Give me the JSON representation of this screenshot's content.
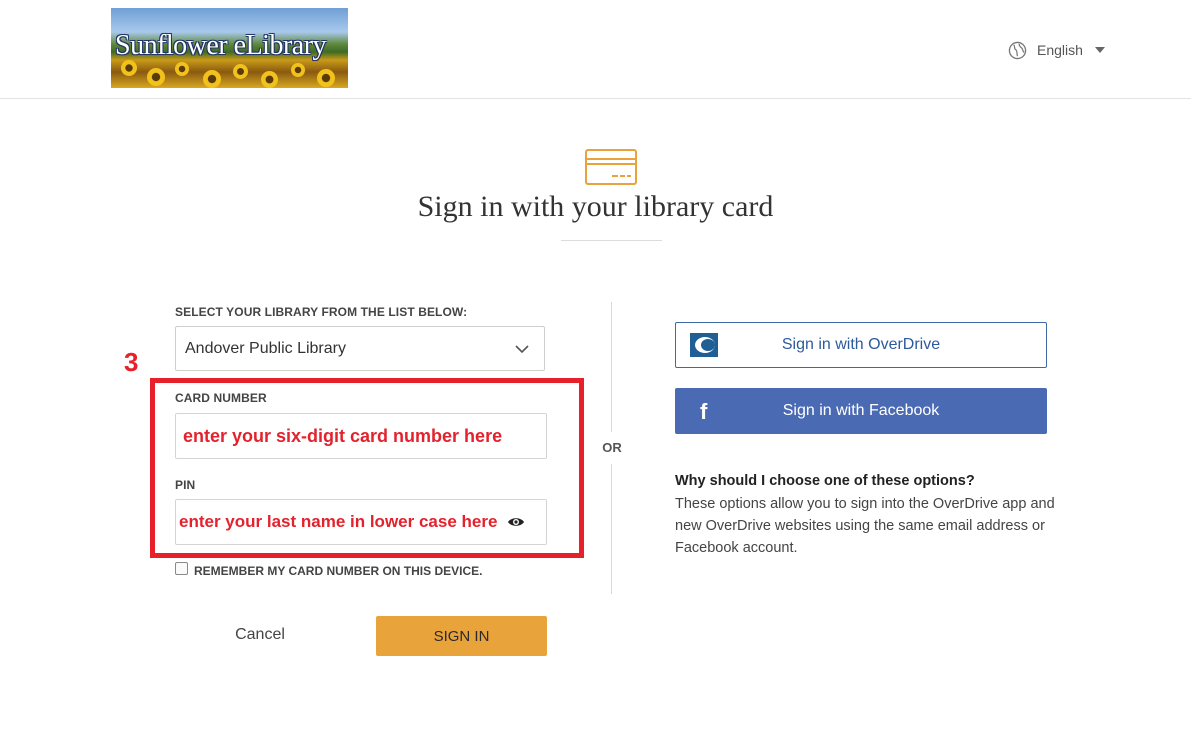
{
  "header": {
    "logo_text": "Sunflower eLibrary",
    "language": "English"
  },
  "page": {
    "title": "Sign in with your library card"
  },
  "form": {
    "library_label": "SELECT YOUR LIBRARY FROM THE LIST BELOW:",
    "library_selected": "Andover Public Library",
    "step_number": "3",
    "card_label": "CARD NUMBER",
    "card_value": "enter your six-digit card number here",
    "pin_label": "PIN",
    "pin_value": "enter your last name in lower case here",
    "remember_label": "REMEMBER MY CARD NUMBER ON THIS DEVICE.",
    "cancel_label": "Cancel",
    "signin_label": "SIGN IN"
  },
  "divider": {
    "or_label": "OR"
  },
  "alt_signin": {
    "overdrive_label": "Sign in with OverDrive",
    "facebook_label": "Sign in with Facebook",
    "why_title": "Why should I choose one of these options?",
    "why_body": "These options allow you to sign into the OverDrive app and new OverDrive websites using the same email address or Facebook account."
  },
  "colors": {
    "accent_orange": "#e8a33a",
    "annotation_red": "#e8202a",
    "facebook_blue": "#4a6ab3",
    "overdrive_blue": "#2d5b9a"
  },
  "icons": [
    "globe-icon",
    "chevron-down-icon",
    "library-card-icon",
    "eye-icon",
    "overdrive-icon",
    "facebook-icon"
  ]
}
